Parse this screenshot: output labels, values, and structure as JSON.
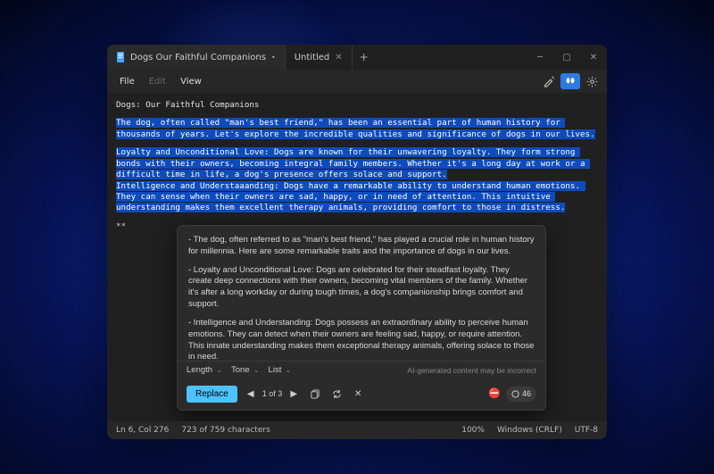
{
  "window": {
    "tabs": [
      {
        "label": "Dogs Our Faithful Companions",
        "dirty": "•",
        "active": true
      },
      {
        "label": "Untitled",
        "dirty": "",
        "active": false
      }
    ]
  },
  "menu": {
    "file": "File",
    "edit": "Edit",
    "view": "View"
  },
  "document": {
    "title": "Dogs: Our Faithful Companions",
    "p1": "The dog, often called \"man's best friend,\" has been an essential part of human history for thousands of years. Let's explore the incredible qualities and significance of dogs in our lives.",
    "p2": "Loyalty and Unconditional Love: Dogs are known for their unwavering loyalty. They form strong bonds with their owners, becoming integral family members. Whether it's a long day at work or a difficult time in life, a dog's presence offers solace and support.",
    "p3": "Intelligence and Understaaanding: Dogs have a remarkable ability to understand human emotions. They can sense when their owners are sad, happy, or in need of attention. This intuitive understanding makes them excellent therapy animals, providing comfort to those in distress.",
    "trailing": "**"
  },
  "rewrite": {
    "s1": "- The dog, often referred to as \"man's best friend,\" has played a crucial role in human history for millennia. Here are some remarkable traits and the importance of dogs in our lives.",
    "s2": "- Loyalty and Unconditional Love: Dogs are celebrated for their steadfast loyalty. They create deep connections with their owners, becoming vital members of the family. Whether it's after a long workday or during tough times, a dog's companionship brings comfort and support.",
    "s3": "- Intelligence and Understanding: Dogs possess an extraordinary ability to perceive human emotions. They can detect when their owners are feeling sad, happy, or require attention. This innate understanding makes them exceptional therapy animals, offering solace to those in need.",
    "options": {
      "length": "Length",
      "tone": "Tone",
      "list": "List"
    },
    "disclaimer": "AI-generated content may be incorrect",
    "replace": "Replace",
    "pager": "1 of 3",
    "tokens": "46"
  },
  "status": {
    "pos": "Ln 6, Col 276",
    "chars": "723 of 759 characters",
    "zoom": "100%",
    "eol": "Windows (CRLF)",
    "encoding": "UTF-8"
  }
}
